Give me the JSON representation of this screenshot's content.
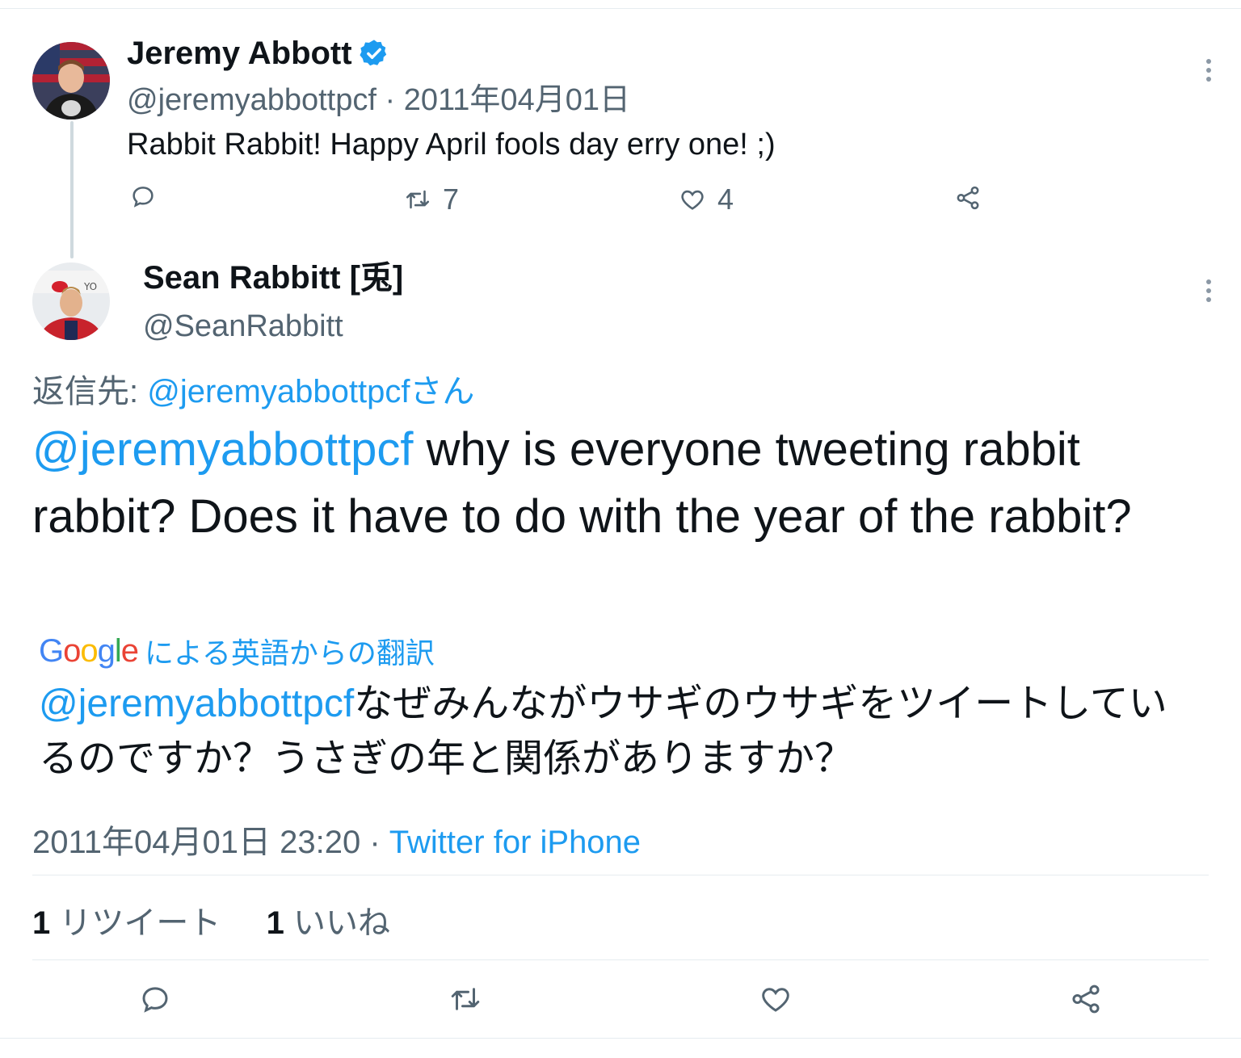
{
  "parent_tweet": {
    "name": "Jeremy Abbott",
    "verified": true,
    "handle": "@jeremyabbottpcf",
    "separator": "·",
    "date": "2011年04月01日",
    "text": "Rabbit Rabbit! Happy April fools day erry one! ;)",
    "actions": {
      "reply_icon": "reply-icon",
      "retweet_icon": "retweet-icon",
      "retweet_count": "7",
      "like_icon": "like-icon",
      "like_count": "4",
      "share_icon": "share-icon"
    }
  },
  "main_tweet": {
    "name": "Sean Rabbitt [兎]",
    "handle": "@SeanRabbitt",
    "replying_label": "返信先: ",
    "replying_to": "@jeremyabbottpcfさん",
    "mention": "@jeremyabbottpcf",
    "text": " why is everyone tweeting rabbit rabbit? Does it have to do with the year of the rabbit?",
    "translation_label": "による英語からの翻訳",
    "translation_mention": "@jeremyabbottpcf",
    "translation_text": "なぜみんながウサギのウサギをツイートしているのですか？うさぎの年と関係がありますか？",
    "timestamp": "2011年04月01日 23:20",
    "separator": "·",
    "source": "Twitter for iPhone",
    "retweet_count": "1",
    "retweet_label": "リツイート",
    "like_count": "1",
    "like_label": "いいね"
  },
  "colors": {
    "accent": "#1d9bf0",
    "secondary_text": "#536471",
    "divider": "#e6ecf0"
  }
}
